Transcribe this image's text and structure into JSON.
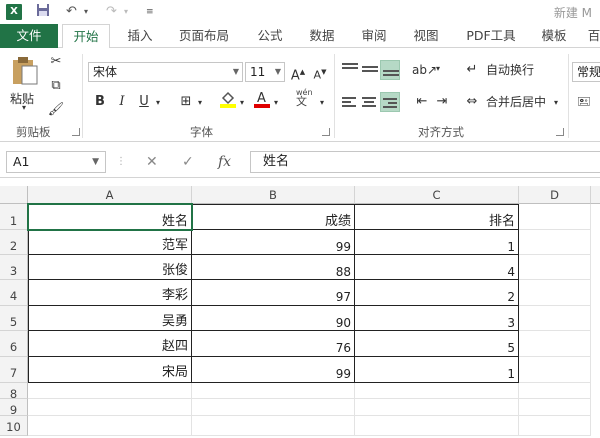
{
  "title_bar": {
    "app_icon_letter": "X",
    "window_title": "新建 M"
  },
  "tabs": [
    "文件",
    "开始",
    "插入",
    "页面布局",
    "公式",
    "数据",
    "审阅",
    "视图",
    "PDF工具",
    "模板",
    "百"
  ],
  "ribbon": {
    "clipboard": {
      "paste_label": "粘贴",
      "group_label": "剪贴板"
    },
    "font": {
      "font_name": "宋体",
      "font_size": "11",
      "bold": "B",
      "italic": "I",
      "underline": "U",
      "phonetic": "wén",
      "group_label": "字体"
    },
    "alignment": {
      "wrap_text": "自动换行",
      "merge_center": "合并后居中",
      "group_label": "对齐方式"
    },
    "number": {
      "format": "常规"
    }
  },
  "formula_bar": {
    "name_box": "A1",
    "fx": "fx",
    "formula": "姓名"
  },
  "grid": {
    "columns": [
      "A",
      "B",
      "C",
      "D"
    ],
    "rows": [
      "1",
      "2",
      "3",
      "4",
      "5",
      "6",
      "7",
      "8",
      "9",
      "10"
    ],
    "headers": [
      "姓名",
      "成绩",
      "排名"
    ],
    "data": [
      [
        "范军",
        "99",
        "1"
      ],
      [
        "张俊",
        "88",
        "4"
      ],
      [
        "李彩",
        "97",
        "2"
      ],
      [
        "吴勇",
        "90",
        "3"
      ],
      [
        "赵四",
        "76",
        "5"
      ],
      [
        "宋局",
        "99",
        "1"
      ]
    ]
  },
  "colors": {
    "accent": "#217346",
    "selected": "#b6d9c6"
  }
}
